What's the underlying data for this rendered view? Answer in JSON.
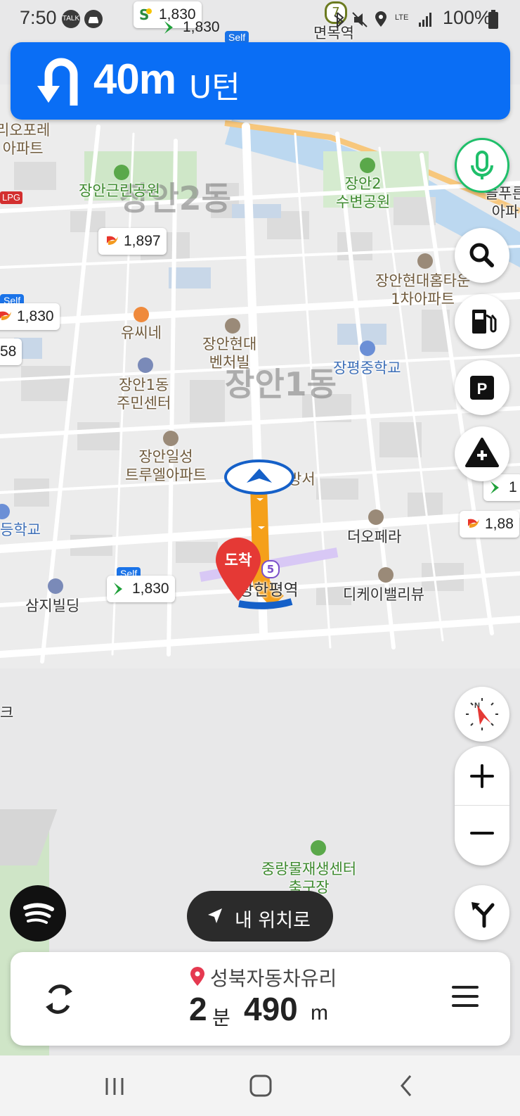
{
  "status_bar": {
    "time": "7:50",
    "icons": [
      "talk-icon",
      "car-icon",
      "bluetooth-icon",
      "mute-icon",
      "location-icon",
      "lte-icon",
      "signal-icon",
      "battery-icon"
    ],
    "lte": "LTE",
    "talk": "TALK",
    "battery": "100%"
  },
  "turn": {
    "distance": "40m",
    "instruction": "U턴",
    "icon": "u-turn-icon"
  },
  "map": {
    "districts": [
      "장안2동",
      "장안1동"
    ],
    "places": {
      "myeonmok_station": "면목역",
      "stationlabel_num": "7",
      "leo_apt": "리오포레\n아파트",
      "janganggeunrin_park": "장안근린공원",
      "jangan2_park": "장안2\n수변공원",
      "jangan_hyundai_home": "장안현대홈타운\n1차아파트",
      "usine": "유씨네",
      "jangan_hyundai_venture": "장안현대\n벤처빌",
      "jangpyeong_school": "장평중학교",
      "jangan1_center": "장안1동\n주민센터",
      "jangan_ilsung": "장안일성\n트루엘아파트",
      "bangseo": "방서",
      "deungschool": "등학교",
      "theopera": "더오페라",
      "samji": "삼지빌딩",
      "janghanpyeong": "장한평역",
      "dk_valley": "디케이밸리뷰",
      "junglang": "중랑물재생센터\n축구장",
      "neulpureun": "늘푸른\n아파",
      "arrival": "도착",
      "line5": "5",
      "ke": "크"
    },
    "gas_prices": [
      {
        "brand": "S-OIL",
        "price": "1,830"
      },
      {
        "brand": "GS",
        "price": "1,830"
      },
      {
        "brand": "SK",
        "price": "1,897"
      },
      {
        "brand": "SK",
        "price": "1,830"
      },
      {
        "brand": "other",
        "price": "58"
      },
      {
        "brand": "GS",
        "price": "1,830"
      },
      {
        "brand": "GS",
        "price": "1"
      },
      {
        "brand": "SK",
        "price": "1,88"
      }
    ],
    "self_label": "Self",
    "sk_label": "SK",
    "lpg_label": "LPG"
  },
  "side_buttons": [
    "voice-icon",
    "search-icon",
    "fuel-icon",
    "parking-icon",
    "hazard-report-icon"
  ],
  "compass_label": "N",
  "my_location": {
    "label": "내 위치로"
  },
  "route": {
    "destination": "성북자동차유리",
    "eta_minutes": "2",
    "eta_minutes_unit": "분",
    "distance": "490",
    "distance_unit": "m"
  },
  "colors": {
    "banner": "#0a6ef5",
    "route": "#f5a01a",
    "voice": "#1fbf6a",
    "destination": "#e53935"
  }
}
